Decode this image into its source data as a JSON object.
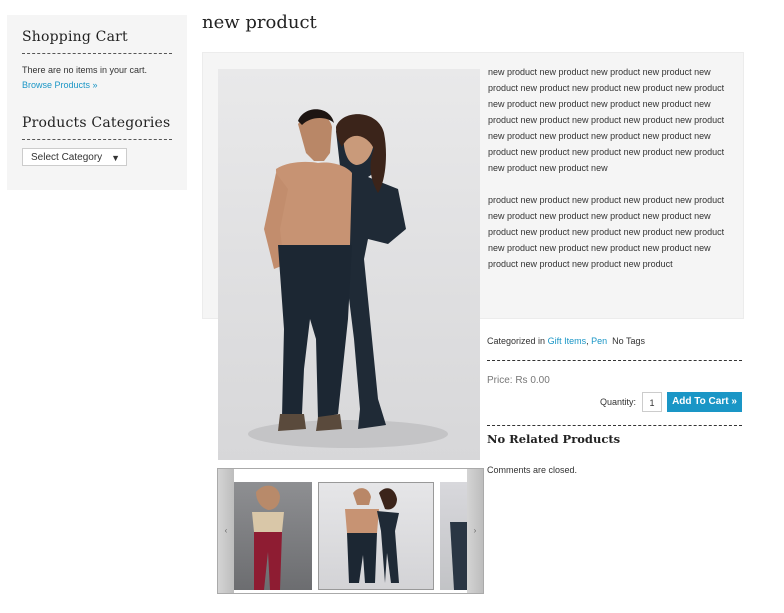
{
  "sidebar": {
    "cart_title": "Shopping Cart",
    "cart_empty": "There are no items in your cart.",
    "browse_link": "Browse Products »",
    "categories_title": "Products Categories",
    "select_label": "Select Category"
  },
  "product": {
    "title": "new product",
    "description_p1": "new product new product new product new product new product new product new product new product new product new product new product new product new product new product new product new product new product new product new product new product new product new product new product new product new product new product new product new product new product new",
    "description_p2": "product new product new product new product new product new product new product new product new product new product new product new product new product new product new product new product new product new product new product new product new product new product",
    "categorized_label": "Categorized in",
    "category_1": "Gift Items",
    "category_sep": ",",
    "category_2": "Pen",
    "tags": "No Tags",
    "price": "Price: Rs 0.00",
    "quantity_label": "Quantity:",
    "quantity_value": "1",
    "add_to_cart": "Add To Cart »",
    "related": "No Related Products",
    "comments": "Comments are closed."
  },
  "carousel": {
    "prev_arrow": "‹",
    "next_arrow": "›"
  },
  "colors": {
    "link": "#1a96c6",
    "button_bg": "#1a96c6",
    "panel_bg": "#f5f5f5"
  }
}
